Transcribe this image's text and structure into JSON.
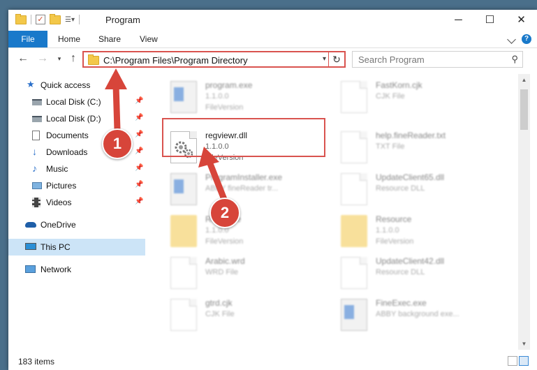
{
  "window": {
    "title": "Program",
    "controls": [
      "─",
      "☐",
      "✕"
    ]
  },
  "ribbon": {
    "file_tab": "File",
    "tabs": [
      "Home",
      "Share",
      "View"
    ]
  },
  "address_bar": {
    "path": "C:\\Program Files\\Program Directory",
    "refresh_glyph": "↻",
    "dropdown_glyph": "▾"
  },
  "search": {
    "placeholder": "Search Program"
  },
  "sidebar": {
    "items": [
      {
        "label": "Quick access",
        "icon": "star-icon",
        "pinned": false
      },
      {
        "label": "Local Disk (C:)",
        "icon": "drive-icon",
        "pinned": true
      },
      {
        "label": "Local Disk (D:)",
        "icon": "drive-icon",
        "pinned": true
      },
      {
        "label": "Documents",
        "icon": "documents-icon",
        "pinned": true
      },
      {
        "label": "Downloads",
        "icon": "download-icon",
        "pinned": true
      },
      {
        "label": "Music",
        "icon": "music-icon",
        "pinned": true
      },
      {
        "label": "Pictures",
        "icon": "pictures-icon",
        "pinned": true
      },
      {
        "label": "Videos",
        "icon": "videos-icon",
        "pinned": true
      },
      {
        "label": "OneDrive",
        "icon": "cloud-icon",
        "pinned": false
      },
      {
        "label": "This PC",
        "icon": "computer-icon",
        "pinned": false,
        "selected": true
      },
      {
        "label": "Network",
        "icon": "network-icon",
        "pinned": false
      }
    ]
  },
  "files": [
    {
      "name": "program.exe",
      "line2": "1.1.0.0",
      "line3": "FileVersion",
      "kind": "exe",
      "blurred": true
    },
    {
      "name": "FastKorn.cjk",
      "line2": "CJK File",
      "line3": "",
      "kind": "doc",
      "blurred": true
    },
    {
      "name": "regviewr.dll",
      "line2": "1.1.0.0",
      "line3": "FileVersion",
      "kind": "dll",
      "blurred": false
    },
    {
      "name": "help.fineReader.txt",
      "line2": "TXT File",
      "line3": "",
      "kind": "doc",
      "blurred": true
    },
    {
      "name": "ProgramInstaller.exe",
      "line2": "ABBY fineReader tr...",
      "line3": "",
      "kind": "exe",
      "blurred": true
    },
    {
      "name": "UpdateClient65.dll",
      "line2": "Resource DLL",
      "line3": "",
      "kind": "dll",
      "blurred": true
    },
    {
      "name": "Resource",
      "line2": "1.1.0.0",
      "line3": "FileVersion",
      "kind": "folder",
      "blurred": true
    },
    {
      "name": "Resource",
      "line2": "1.1.0.0",
      "line3": "FileVersion",
      "kind": "folder",
      "blurred": true
    },
    {
      "name": "Arabic.wrd",
      "line2": "WRD File",
      "line3": "",
      "kind": "doc",
      "blurred": true
    },
    {
      "name": "UpdateClient42.dll",
      "line2": "Resource DLL",
      "line3": "",
      "kind": "dll",
      "blurred": true
    },
    {
      "name": "gtrd.cjk",
      "line2": "CJK File",
      "line3": "",
      "kind": "doc",
      "blurred": true
    },
    {
      "name": "FineExec.exe",
      "line2": "ABBY background exe...",
      "line3": "",
      "kind": "exe",
      "blurred": true
    }
  ],
  "status": {
    "item_count": "183 items"
  },
  "markers": [
    "1",
    "2"
  ],
  "colors": {
    "accent": "#1979ca",
    "highlight_border": "#d9534f",
    "marker": "#d7453a",
    "selected_nav": "#cce4f7"
  }
}
